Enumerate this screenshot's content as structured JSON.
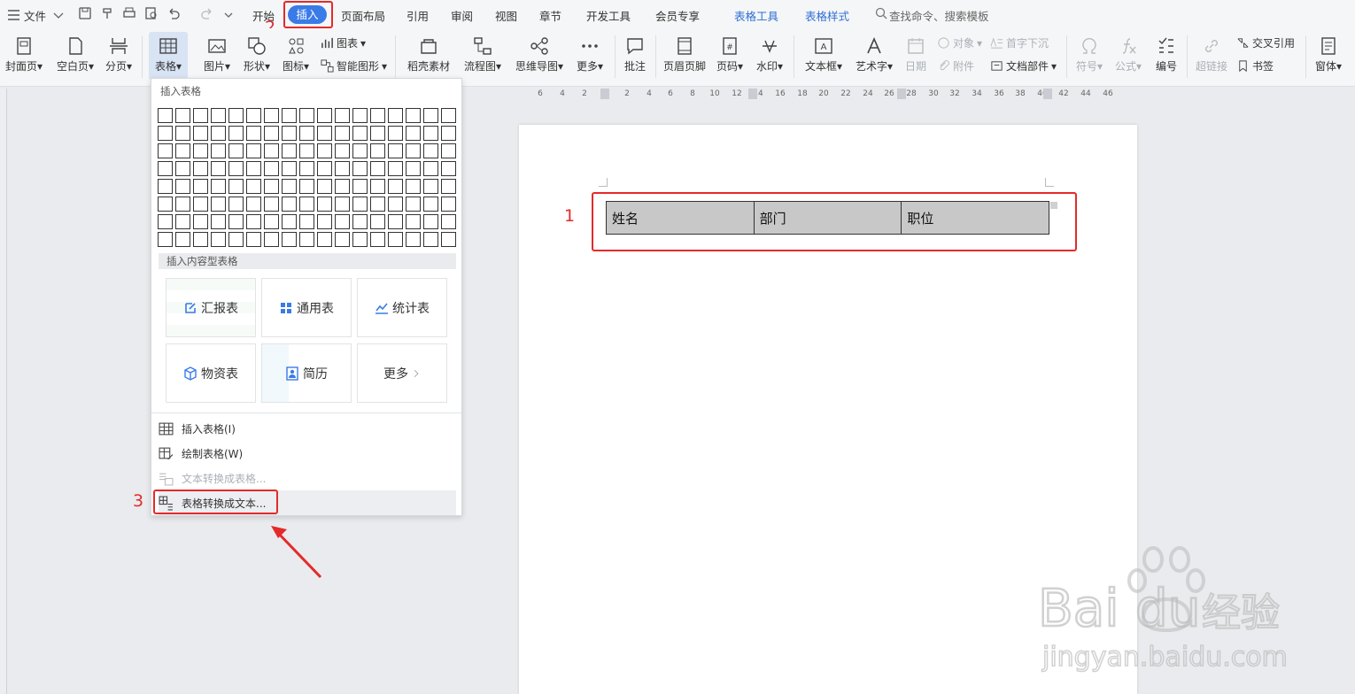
{
  "menubar": {
    "file_label": "文件",
    "tabs": {
      "start": "开始",
      "insert": "插入",
      "page_layout": "页面布局",
      "references": "引用",
      "review": "审阅",
      "view": "视图",
      "section": "章节",
      "developer": "开发工具",
      "member": "会员专享",
      "table_tools": "表格工具",
      "table_style": "表格样式"
    },
    "search_placeholder": "查找命令、搜索模板"
  },
  "ribbon": {
    "cover": "封面页",
    "blank": "空白页",
    "page_break": "分页",
    "table": "表格",
    "picture": "图片",
    "shape": "形状",
    "icon": "图标",
    "chart": "图表",
    "smart_shape": "智能图形",
    "material": "稻壳素材",
    "flowchart": "流程图",
    "mindmap": "思维导图",
    "more": "更多",
    "comment": "批注",
    "header_footer": "页眉页脚",
    "page_number": "页码",
    "watermark": "水印",
    "textbox": "文本框",
    "wordart": "艺术字",
    "object": "对象",
    "date": "日期",
    "drop_cap": "首字下沉",
    "attachment": "附件",
    "doc_parts": "文档部件",
    "symbol": "符号",
    "formula": "公式",
    "numbering": "编号",
    "hyperlink": "超链接",
    "cross_ref": "交叉引用",
    "bookmark": "书签",
    "window": "窗体"
  },
  "ruler": [
    "6",
    "4",
    "2",
    "2",
    "4",
    "6",
    "8",
    "10",
    "12",
    "14",
    "16",
    "18",
    "20",
    "22",
    "24",
    "26",
    "28",
    "30",
    "32",
    "34",
    "36",
    "38",
    "40",
    "42",
    "44",
    "46"
  ],
  "document": {
    "table_headers": [
      "姓名",
      "部门",
      "职位"
    ]
  },
  "annotations": {
    "step1": "1",
    "step2": "2",
    "step3": "3"
  },
  "dropdown": {
    "title": "插入表格",
    "section_title": "插入内容型表格",
    "templates": {
      "report": "汇报表",
      "general": "通用表",
      "stats": "统计表",
      "inventory": "物资表",
      "resume": "简历",
      "more": "更多"
    },
    "items": {
      "insert_table": "插入表格(I)",
      "draw_table": "绘制表格(W)",
      "text_to_table": "文本转换成表格...",
      "table_to_text": "表格转换成文本..."
    }
  },
  "colors": {
    "accent": "#3a7be8",
    "highlight_red": "#e42a2a",
    "table_tab_blue": "#2f6fd6"
  }
}
